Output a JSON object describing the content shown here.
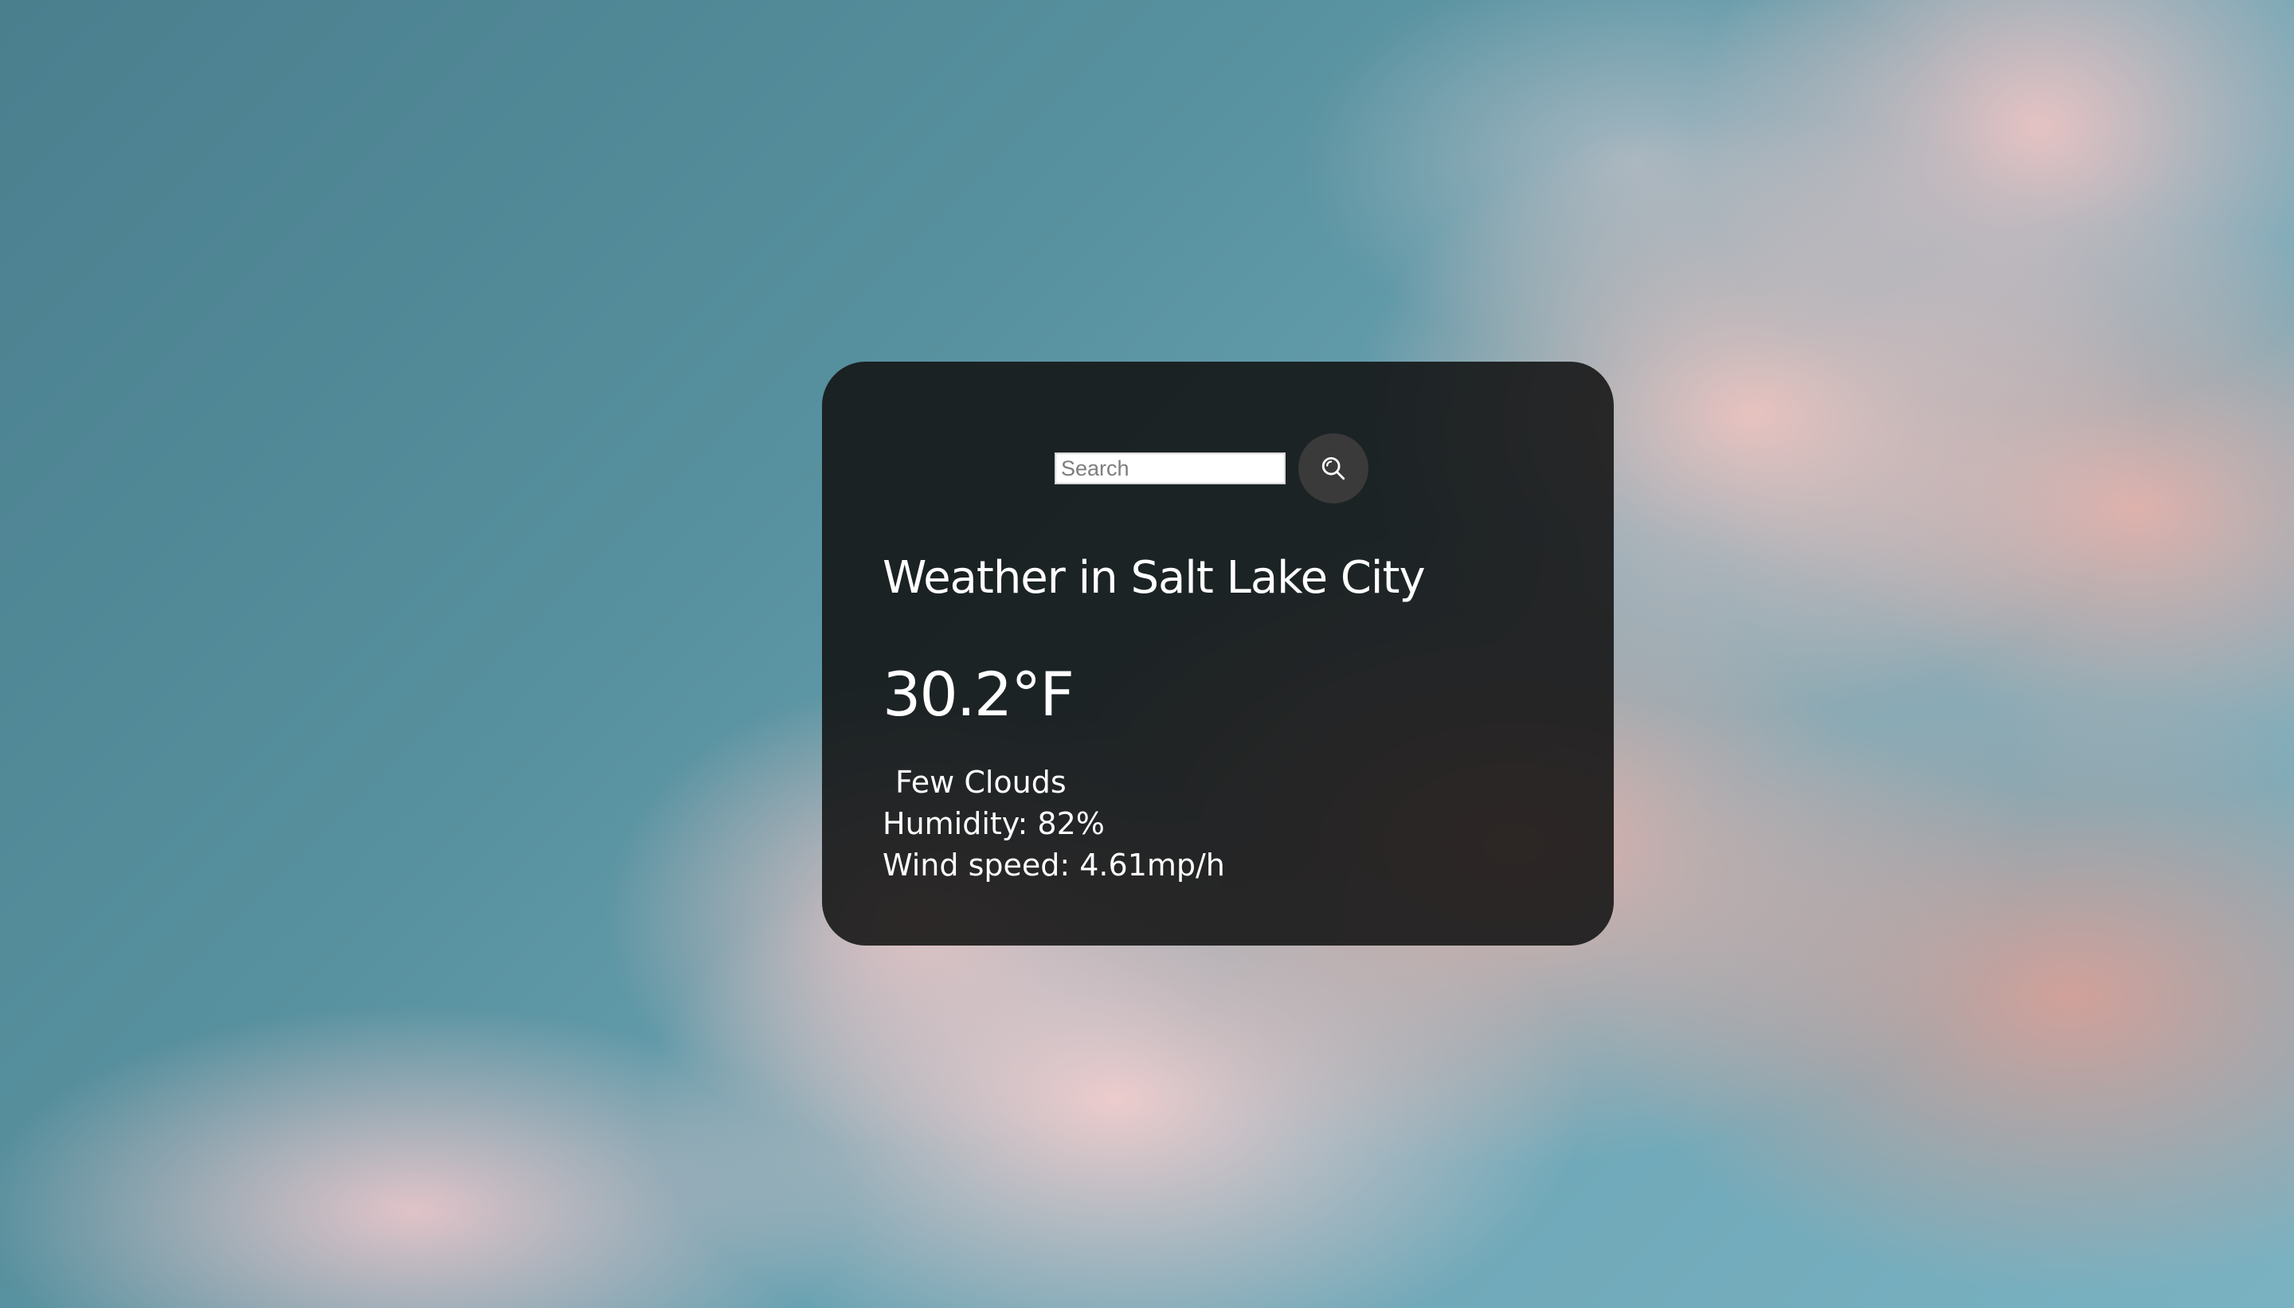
{
  "search": {
    "placeholder": "Search",
    "value": "",
    "button_icon": "search-icon"
  },
  "weather": {
    "title": "Weather in Salt Lake City",
    "temperature": "30.2°F",
    "description": "Few Clouds",
    "humidity": "Humidity: 82%",
    "wind": "Wind speed: 4.61mp/h"
  },
  "colors": {
    "card_background": "#111111",
    "text": "#ffffff",
    "search_button": "#3a3a3a"
  }
}
